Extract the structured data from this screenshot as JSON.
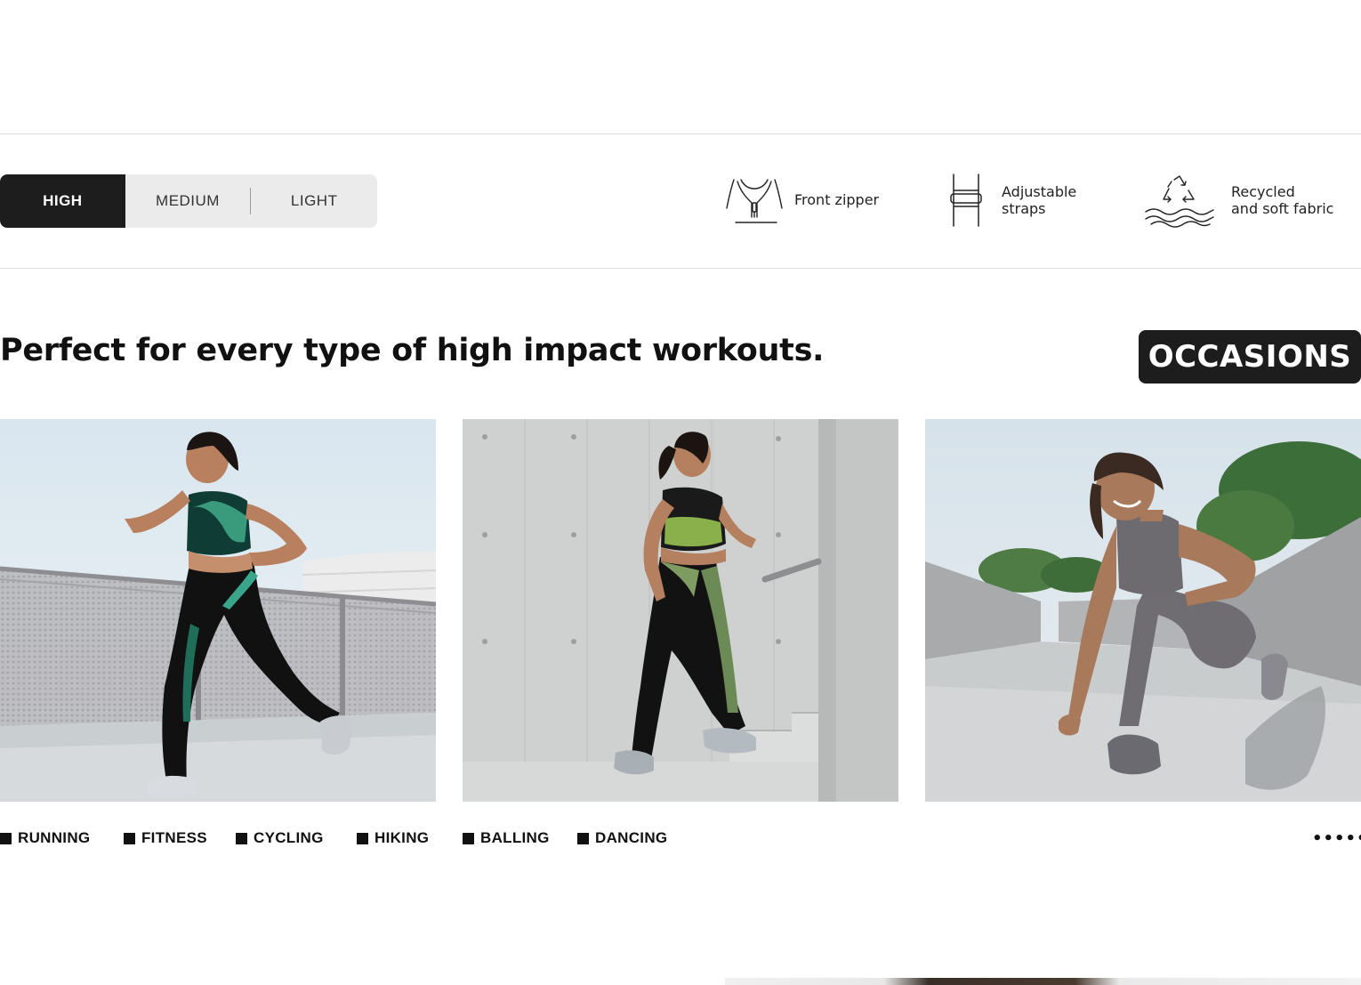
{
  "impact_levels": {
    "tabs": [
      "HIGH",
      "MEDIUM",
      "LIGHT"
    ],
    "selected": "HIGH"
  },
  "features": [
    {
      "icon": "front-zipper-icon",
      "label": "Front zipper"
    },
    {
      "icon": "adjustable-straps-icon",
      "label": "Adjustable\nstraps"
    },
    {
      "icon": "recycle-fabric-icon",
      "label": "Recycled\nand soft fabric"
    }
  ],
  "section": {
    "headline": "Perfect for every type of high impact workouts.",
    "badge": "OCCASIONS"
  },
  "photos": [
    {
      "alt": "woman running on rooftop in black leggings and patterned sports bra"
    },
    {
      "alt": "woman climbing concrete stairs in green camo sports bra and leggings"
    },
    {
      "alt": "woman stretching in lunge on concrete walkway in grey activewear"
    }
  ],
  "activities": [
    "RUNNING",
    "FITNESS",
    "CYCLING",
    "HIKING",
    "BALLING",
    "DANCING"
  ],
  "more_indicator": "••••••",
  "colors": {
    "dark": "#1d1d1d",
    "tab_bg": "#ebebeb",
    "divider": "#dcdcdc"
  }
}
